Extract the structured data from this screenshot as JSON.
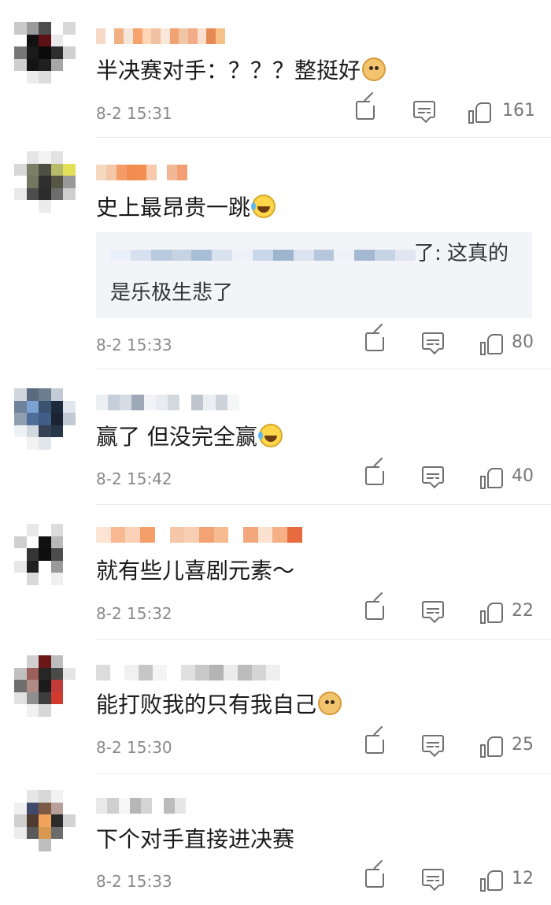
{
  "comments": [
    {
      "id": 1,
      "avatar_colors": [
        "#c9c9c9",
        "#9b9b9b",
        "#4d4d4d",
        "#ffffff",
        "#d8d8d8",
        "#ffffff",
        "#111111",
        "#5b1116",
        "#eaeaea",
        "#ffffff",
        "#777777",
        "#1a1a1a",
        "#0b0b0b",
        "#2d2d2d",
        "#d0d0d0",
        "#cfcfcf",
        "#141414",
        "#1f1f1f",
        "#a7a7a7",
        "#ffffff",
        "#ffffff",
        "#ececec",
        "#dcdcdc",
        "#ffffff",
        "#ffffff"
      ],
      "name_colors": [
        "#f8d9c8",
        "#ffffff",
        "#f2b184",
        "#f4e6da",
        "#f6a26f",
        "#ffd7b8",
        "#f3c1a4",
        "#fbe7d9",
        "#f2a173",
        "#f0c6a7",
        "#f2ad88",
        "#fbe0cf",
        "#e68a55",
        "#f7c089"
      ],
      "text": "半决赛对手：？？？整挺好",
      "emoji": "doge-emoji",
      "time": "8-2 15:31",
      "likes": "161",
      "has_reply": false
    },
    {
      "id": 2,
      "avatar_colors": [
        "#ffffff",
        "#e6e6e6",
        "#f3f3f3",
        "#e2e2e2",
        "#ffffff",
        "#d7d7d7",
        "#7b7f66",
        "#4e5046",
        "#b7b96b",
        "#e4df55",
        "#ffffff",
        "#73775d",
        "#2f2f2f",
        "#555544",
        "#999999",
        "#e9e9e9",
        "#4d4d4d",
        "#2c2c2c",
        "#6d6d6d",
        "#cfcfcf",
        "#ffffff",
        "#ffffff",
        "#ececec",
        "#ffffff",
        "#ffffff"
      ],
      "name_colors": [
        "#f4d8c0",
        "#f4c7a8",
        "#f59b66",
        "#f38b4e",
        "#f48d50",
        "#f9c9ad",
        "#ffffff",
        "#f2b896",
        "#f39f74"
      ],
      "text": "史上最昂贵一跳",
      "emoji": "laugh-cry-emoji",
      "reply_blur_colors": [
        "#eaf0fa",
        "#d6e0ef",
        "#b9c9de",
        "#c7d2e2",
        "#a9bfd8",
        "#d8e1ee",
        "#eef2f8",
        "#c9d7ea",
        "#9fb4cf",
        "#dbe3f0",
        "#b6c6dc",
        "#eef2f8",
        "#a5b8d2",
        "#c6d4e6",
        "#dfe6f1"
      ],
      "reply_prefix": "了:",
      "reply_line1": "这真的",
      "reply_line2": "是乐极生悲了",
      "time": "8-2 15:33",
      "likes": "80",
      "has_reply": true
    },
    {
      "id": 3,
      "avatar_colors": [
        "#cfd6de",
        "#5a6b7f",
        "#6d7d90",
        "#c3ccd6",
        "#ffffff",
        "#6e8299",
        "#7aa2d2",
        "#3a5170",
        "#1d2a3b",
        "#e0e6ed",
        "#8f9fb0",
        "#4e6f9a",
        "#3f5d86",
        "#1b2433",
        "#c0c9d4",
        "#eff2f5",
        "#d2d8df",
        "#354154",
        "#28364a",
        "#ffffff",
        "#ffffff",
        "#f2f2f2",
        "#e1e6eb",
        "#ffffff",
        "#ffffff"
      ],
      "name_colors": [
        "#eceff4",
        "#c6ced9",
        "#d6dce5",
        "#9ea8b6",
        "#f1f3f6",
        "#e8ebf0",
        "#d3d8df",
        "#ffffff",
        "#bfc6d0",
        "#ebeef2",
        "#cdd3db",
        "#f4f6f8"
      ],
      "text": "赢了 但没完全赢",
      "emoji": "laugh-cry-emoji",
      "time": "8-2 15:42",
      "likes": "40",
      "has_reply": false
    },
    {
      "id": 4,
      "avatar_colors": [
        "#ffffff",
        "#e8e8e8",
        "#ffffff",
        "#dcdcdc",
        "#ffffff",
        "#cfcfcf",
        "#ffffff",
        "#111111",
        "#b9b9b9",
        "#ffffff",
        "#ffffff",
        "#353535",
        "#0e0e0e",
        "#4c4c4c",
        "#ffffff",
        "#e7e7e7",
        "#202020",
        "#ffffff",
        "#9a9a9a",
        "#ffffff",
        "#ffffff",
        "#d9d9d9",
        "#ffffff",
        "#f0f0f0",
        "#ffffff"
      ],
      "name_colors": [
        "#fde3d4",
        "#f7b892",
        "#fbd2b8",
        "#f49e6a",
        "#ffffff",
        "#f6c6a8",
        "#f8ceb4",
        "#f3a373",
        "#f7bb92",
        "#ffffff",
        "#f2a77c",
        "#fbe1d0",
        "#f5b085",
        "#e86b3f"
      ],
      "text": "就有些儿喜剧元素～",
      "emoji": "",
      "time": "8-2 15:32",
      "likes": "22",
      "has_reply": false
    },
    {
      "id": 5,
      "avatar_colors": [
        "#ffffff",
        "#d0d0d0",
        "#6a1717",
        "#bdbdbd",
        "#ffffff",
        "#c0c0c0",
        "#9c5f5a",
        "#262626",
        "#4a4a4a",
        "#e4e4e4",
        "#6e6e6e",
        "#b08b86",
        "#1c1c1c",
        "#c23b3b",
        "#ffffff",
        "#e1e1e1",
        "#8f8f8f",
        "#3d3d3d",
        "#d13a2c",
        "#ffffff",
        "#ffffff",
        "#f1f1f1",
        "#d7d7d7",
        "#ffffff",
        "#ffffff"
      ],
      "name_colors": [
        "#dcdcdc",
        "#ffffff",
        "#f1f1f1",
        "#c6c6c6",
        "#f4f4f4",
        "#ffffff",
        "#e0e0e0",
        "#c9c9c9",
        "#b4b4b4",
        "#ececec",
        "#bcbcbc",
        "#d5d5d5",
        "#efefef"
      ],
      "text": "能打败我的只有我自己",
      "emoji": "doge-emoji",
      "time": "8-2 15:30",
      "likes": "25",
      "has_reply": false
    },
    {
      "id": 6,
      "avatar_colors": [
        "#ffffff",
        "#e6e6e6",
        "#d8d8d8",
        "#f2f2f2",
        "#ffffff",
        "#f0f0f0",
        "#404a6d",
        "#7d5a45",
        "#b7a09a",
        "#ffffff",
        "#cfcfcf",
        "#4f3a30",
        "#f1a45b",
        "#2b2b2b",
        "#d3d3d3",
        "#ececec",
        "#5a5a5a",
        "#d9984f",
        "#6b6b6b",
        "#ffffff",
        "#ffffff",
        "#ffffff",
        "#bdbdbd",
        "#ffffff",
        "#ffffff"
      ],
      "name_colors": [
        "#e9e9e9",
        "#cfcfcf",
        "#f6f6f6",
        "#b7b7b7",
        "#d4d4d4",
        "#ffffff",
        "#bcbcbc",
        "#e7e7e7"
      ],
      "text": "下个对手直接进决赛",
      "emoji": "",
      "time": "8-2 15:33",
      "likes": "12",
      "has_reply": false
    }
  ]
}
